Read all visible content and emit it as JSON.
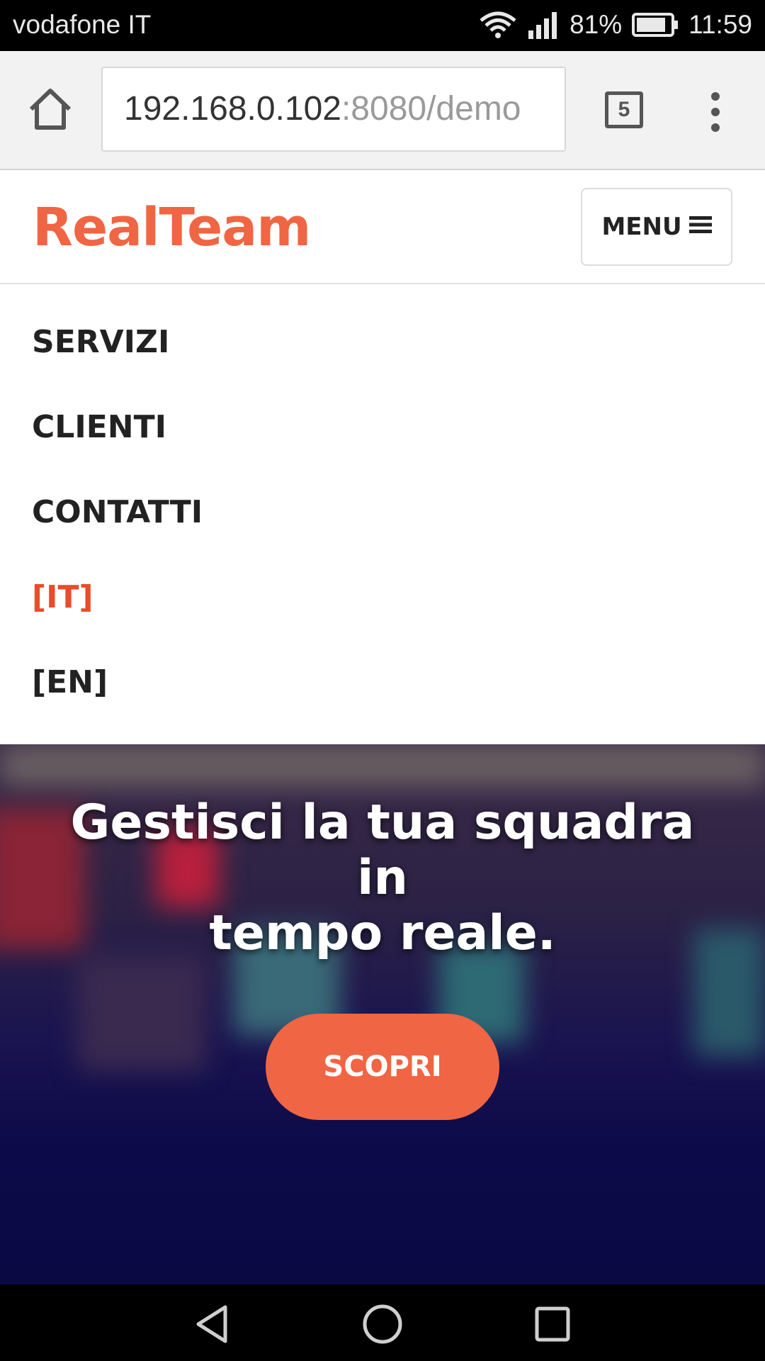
{
  "status_bar": {
    "carrier": "vodafone IT",
    "battery": "81%",
    "time": "11:59",
    "icons": [
      "wifi-icon",
      "signal-icon",
      "battery-icon"
    ]
  },
  "browser": {
    "url_host": "192.168.0.102",
    "url_rest": ":8080/demo",
    "tab_count": "5",
    "icons": [
      "home-icon",
      "tabs-icon",
      "more-vert-icon"
    ]
  },
  "header": {
    "brand": "RealTeam",
    "menu_label": "MENU",
    "menu_icon": "hamburger-icon"
  },
  "nav": {
    "items": [
      {
        "label": "SERVIZI",
        "active": false
      },
      {
        "label": "CLIENTI",
        "active": false
      },
      {
        "label": "CONTATTI",
        "active": false
      },
      {
        "label": "[IT]",
        "active": true
      },
      {
        "label": "[EN]",
        "active": false
      }
    ]
  },
  "hero": {
    "title_line1": "Gestisci la tua squadra in",
    "title_line2": "tempo reale.",
    "cta_label": "SCOPRI"
  },
  "system_nav": {
    "icons": [
      "back-icon",
      "home-circle-icon",
      "recents-icon"
    ]
  },
  "colors": {
    "brand": "#f06543",
    "active_nav": "#ea4c2a",
    "hero_dark": "#0c0a48"
  }
}
